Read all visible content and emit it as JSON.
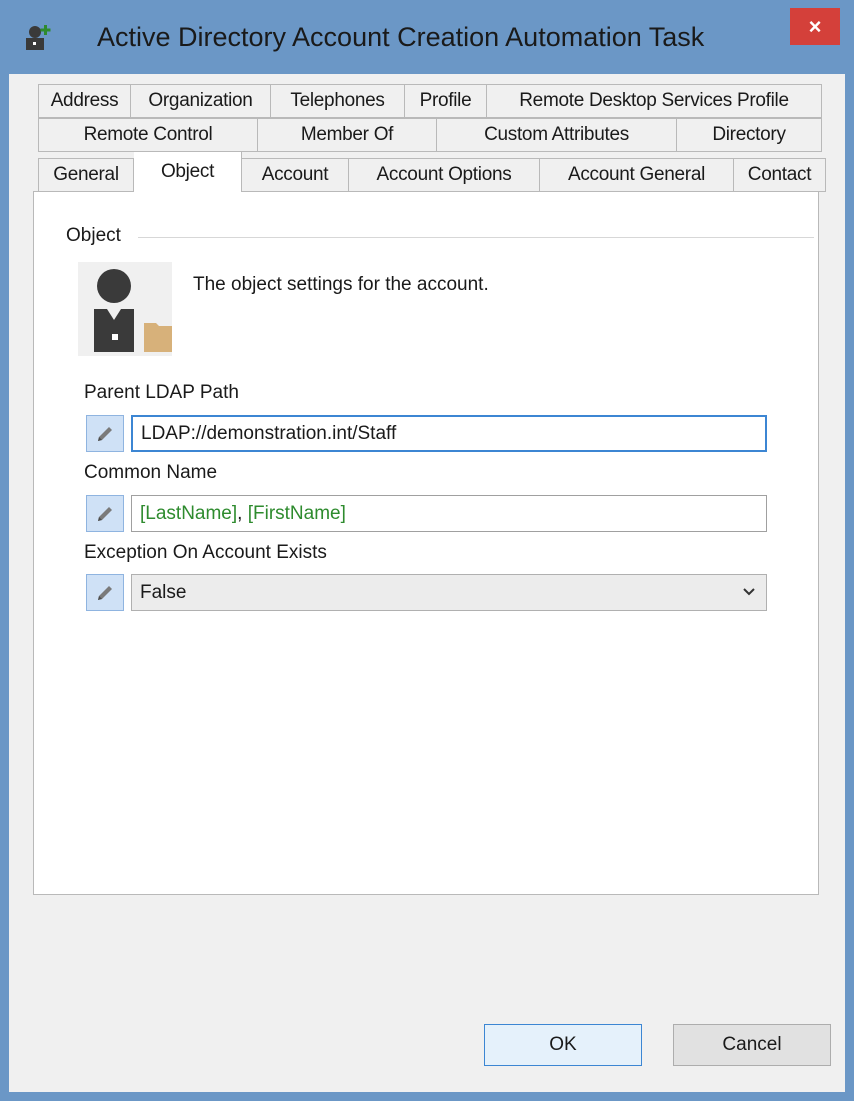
{
  "window": {
    "title": "Active Directory Account Creation Automation Task",
    "close_label": "×"
  },
  "tabs": {
    "row1": [
      "Address",
      "Organization",
      "Telephones",
      "Profile",
      "Remote Desktop Services Profile"
    ],
    "row2": [
      "Remote Control",
      "Member Of",
      "Custom Attributes",
      "Directory"
    ],
    "row3": [
      "General",
      "Object",
      "Account",
      "Account Options",
      "Account General",
      "Contact"
    ],
    "active": "Object"
  },
  "object_panel": {
    "group_title": "Object",
    "description": "The object settings for the account.",
    "parent_ldap_path": {
      "label": "Parent LDAP Path",
      "value": "LDAP://demonstration.int/Staff"
    },
    "common_name": {
      "label": "Common Name",
      "token1": "[LastName]",
      "separator": ", ",
      "token2": "[FirstName]"
    },
    "exception_on_account_exists": {
      "label": "Exception On Account Exists",
      "selected": "False"
    }
  },
  "buttons": {
    "ok": "OK",
    "cancel": "Cancel"
  },
  "colors": {
    "frame": "#6b97c6",
    "close": "#d4403a",
    "token": "#2e8b2e",
    "focus": "#3c86d3"
  },
  "icons": {
    "app": "add-user-icon",
    "avatar": "user-folder-icon",
    "edit": "pencil-icon",
    "dropdown": "chevron-down-icon"
  }
}
